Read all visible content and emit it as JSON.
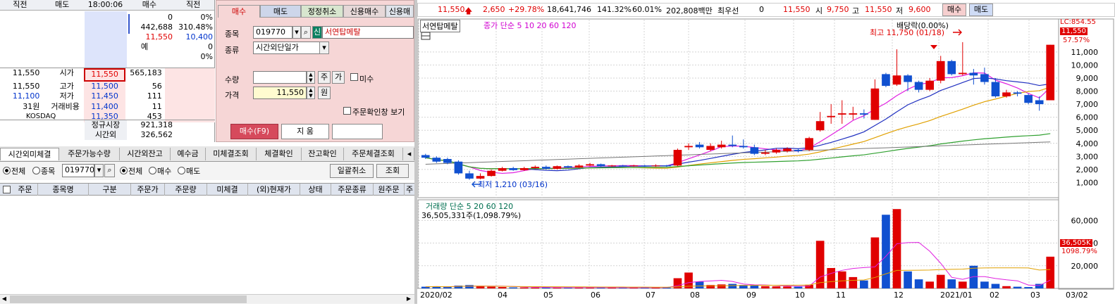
{
  "quote": {
    "header": [
      "직전",
      "매도",
      "18:00:06",
      "매수",
      "직전"
    ],
    "top_right": [
      {
        "bid": "0",
        "pct": "0%"
      },
      {
        "bid": "442,688",
        "pct": "310.48%"
      },
      {
        "bid": "11,550",
        "pct": "10,400"
      },
      {
        "bid": "예",
        "pct": "0"
      },
      {
        "bid": "",
        "pct": "0%"
      }
    ],
    "rows": [
      {
        "price": "11,550",
        "label": "시가",
        "mid": "11,550",
        "vol": "565,183"
      },
      {
        "price": "11,550",
        "label": "고가",
        "mid": "11,500",
        "vol": "56"
      },
      {
        "price": "11,100",
        "label": "저가",
        "mid": "11,450",
        "vol": "111"
      },
      {
        "price": "31원",
        "label": "거래비용",
        "mid": "11,400",
        "vol": "11"
      },
      {
        "price": "KOSDAQ",
        "label": "",
        "mid": "11,350",
        "vol": "453"
      }
    ],
    "footer": [
      {
        "label": "정규시장",
        "value": "921,318"
      },
      {
        "label": "시간외",
        "value": "326,562"
      }
    ]
  },
  "order": {
    "tabs": [
      "매수",
      "매도",
      "정정취소",
      "신용매수",
      "신용매"
    ],
    "code_label": "종목",
    "code": "019770",
    "badge": "신",
    "name": "서연탑메탈",
    "type_label": "종류",
    "type": "시간외단일가",
    "qty_label": "수량",
    "qty": "",
    "qty_btn1": "주",
    "qty_btn2": "가",
    "misu": "미수",
    "price_label": "가격",
    "price": "11,550",
    "price_unit": "원",
    "confirm": "주문확인창 보기",
    "buy": "매수(F9)",
    "clear": "지  움"
  },
  "bottom": {
    "tabs": [
      "시간외미체결",
      "주문가능수량",
      "시간외잔고",
      "예수금",
      "미체결조회",
      "체결확인",
      "잔고확인",
      "주문체결조회"
    ],
    "filter": {
      "all": "전체",
      "stock": "종목",
      "code": "019770",
      "all2": "전체",
      "buy": "매수",
      "sell": "매도",
      "cancel_all": "일괄취소",
      "query": "조회"
    },
    "columns": [
      "주문",
      "종목명",
      "구분",
      "주문가",
      "주문량",
      "미체결",
      "(외)현재가",
      "상태",
      "주문종류",
      "원주문",
      "주"
    ]
  },
  "ticker": {
    "price": "11,550",
    "change": "2,650",
    "change_pct": "+29.78%",
    "volume": "18,641,746",
    "vol_pct": "141.32%",
    "pct2": "60.01%",
    "amount": "202,808백만",
    "priority_label": "최우선",
    "priority": "0",
    "priority_price": "11,550",
    "open_label": "시",
    "open": "9,750",
    "high_label": "고",
    "high": "11,550",
    "low_label": "저",
    "low": "9,600",
    "buy_btn": "매수",
    "sell_btn": "매도"
  },
  "chart_data": {
    "type": "candlestick",
    "title": "서연탑메탈",
    "price_legend": "종가 단순 5 10 20 60 120",
    "volume_legend": "거래량 단순 5 20 60 120",
    "volume_info": "36,505,331주(1,098.79%)",
    "annotations": {
      "dividend": "배당락(0.00%)",
      "high": "최고 11,750 (01/18)",
      "low": "최저 1,210 (03/16)"
    },
    "right_labels": {
      "lc": "LC:854.55",
      "last": "11,550",
      "pct": "57.57%",
      "vol_last": "36,505K",
      "vol_pct": "1098.79%"
    },
    "x_ticks": [
      "2020/02",
      "04",
      "05",
      "06",
      "07",
      "08",
      "09",
      "10",
      "11",
      "12",
      "2021/01",
      "02",
      "03",
      "03/02"
    ],
    "price_ticks": [
      1000,
      2000,
      3000,
      4000,
      5000,
      6000,
      7000,
      8000,
      9000,
      10000,
      11000
    ],
    "price_ylim": [
      0,
      12500
    ],
    "volume_ticks": [
      20000,
      40000,
      60000
    ],
    "volume_ylim": [
      0,
      72000
    ],
    "candles": [
      {
        "o": 3100,
        "c": 2900,
        "h": 3200,
        "l": 2800
      },
      {
        "o": 2900,
        "c": 2600,
        "h": 3000,
        "l": 2500
      },
      {
        "o": 2800,
        "c": 2500,
        "h": 2900,
        "l": 2400
      },
      {
        "o": 2600,
        "c": 1700,
        "h": 2700,
        "l": 1600
      },
      {
        "o": 1700,
        "c": 1300,
        "h": 1900,
        "l": 1210
      },
      {
        "o": 1300,
        "c": 1500,
        "h": 1700,
        "l": 1250
      },
      {
        "o": 1500,
        "c": 1900,
        "h": 2000,
        "l": 1450
      },
      {
        "o": 1900,
        "c": 2100,
        "h": 2200,
        "l": 1850
      },
      {
        "o": 2100,
        "c": 1950,
        "h": 2200,
        "l": 1900
      },
      {
        "o": 1950,
        "c": 2100,
        "h": 2200,
        "l": 1900
      },
      {
        "o": 2100,
        "c": 2200,
        "h": 2300,
        "l": 2050
      },
      {
        "o": 2200,
        "c": 2050,
        "h": 2300,
        "l": 2000
      },
      {
        "o": 2050,
        "c": 2250,
        "h": 2300,
        "l": 2000
      },
      {
        "o": 2250,
        "c": 2150,
        "h": 2300,
        "l": 2100
      },
      {
        "o": 2150,
        "c": 2300,
        "h": 2400,
        "l": 2100
      },
      {
        "o": 2300,
        "c": 2400,
        "h": 2500,
        "l": 2250
      },
      {
        "o": 2400,
        "c": 2250,
        "h": 2450,
        "l": 2200
      },
      {
        "o": 2250,
        "c": 2300,
        "h": 2350,
        "l": 2200
      },
      {
        "o": 2300,
        "c": 2250,
        "h": 2350,
        "l": 2200
      },
      {
        "o": 2250,
        "c": 2300,
        "h": 2350,
        "l": 2200
      },
      {
        "o": 2300,
        "c": 2250,
        "h": 2350,
        "l": 2200
      },
      {
        "o": 2250,
        "c": 2300,
        "h": 2400,
        "l": 2200
      },
      {
        "o": 2300,
        "c": 2250,
        "h": 2350,
        "l": 2200
      },
      {
        "o": 2300,
        "c": 3500,
        "h": 3600,
        "l": 2250
      },
      {
        "o": 3700,
        "c": 3800,
        "h": 4000,
        "l": 3500
      },
      {
        "o": 3900,
        "c": 3700,
        "h": 4100,
        "l": 3600
      },
      {
        "o": 3500,
        "c": 3800,
        "h": 4000,
        "l": 3400
      },
      {
        "o": 3700,
        "c": 3900,
        "h": 4200,
        "l": 3600
      },
      {
        "o": 3900,
        "c": 3800,
        "h": 4600,
        "l": 3700
      },
      {
        "o": 3800,
        "c": 3700,
        "h": 4300,
        "l": 3600
      },
      {
        "o": 3700,
        "c": 3200,
        "h": 3900,
        "l": 3100
      },
      {
        "o": 3200,
        "c": 3300,
        "h": 3500,
        "l": 3100
      },
      {
        "o": 3300,
        "c": 3500,
        "h": 3600,
        "l": 3200
      },
      {
        "o": 3400,
        "c": 3600,
        "h": 3700,
        "l": 3300
      },
      {
        "o": 3500,
        "c": 3400,
        "h": 3600,
        "l": 3300
      },
      {
        "o": 3500,
        "c": 4400,
        "h": 4500,
        "l": 3400
      },
      {
        "o": 5000,
        "c": 5700,
        "h": 6400,
        "l": 4900
      },
      {
        "o": 6000,
        "c": 6100,
        "h": 7000,
        "l": 5500
      },
      {
        "o": 6200,
        "c": 6300,
        "h": 7300,
        "l": 5500
      },
      {
        "o": 6200,
        "c": 6300,
        "h": 6800,
        "l": 5800
      },
      {
        "o": 6300,
        "c": 6200,
        "h": 6600,
        "l": 5900
      },
      {
        "o": 5800,
        "c": 8200,
        "h": 8900,
        "l": 5800
      },
      {
        "o": 9300,
        "c": 8400,
        "h": 9400,
        "l": 8300
      },
      {
        "o": 8500,
        "c": 9200,
        "h": 11200,
        "l": 8400
      },
      {
        "o": 9200,
        "c": 8700,
        "h": 9300,
        "l": 8000
      },
      {
        "o": 8700,
        "c": 8100,
        "h": 8800,
        "l": 7900
      },
      {
        "o": 8100,
        "c": 8800,
        "h": 9000,
        "l": 8000
      },
      {
        "o": 8800,
        "c": 10300,
        "h": 10700,
        "l": 8600
      },
      {
        "o": 10300,
        "c": 9300,
        "h": 10400,
        "l": 9200
      },
      {
        "o": 9300,
        "c": 9400,
        "h": 11750,
        "l": 9200
      },
      {
        "o": 9400,
        "c": 9200,
        "h": 9700,
        "l": 8500
      },
      {
        "o": 9300,
        "c": 8700,
        "h": 9800,
        "l": 8500
      },
      {
        "o": 8700,
        "c": 7600,
        "h": 9000,
        "l": 7500
      },
      {
        "o": 7600,
        "c": 7900,
        "h": 8100,
        "l": 7500
      },
      {
        "o": 7900,
        "c": 7800,
        "h": 8000,
        "l": 7600
      },
      {
        "o": 7700,
        "c": 7100,
        "h": 7800,
        "l": 7000
      },
      {
        "o": 7300,
        "c": 7000,
        "h": 7600,
        "l": 6500
      },
      {
        "o": 7300,
        "c": 11550,
        "h": 11550,
        "l": 7300
      }
    ],
    "volumes": [
      1500,
      1800,
      1200,
      2500,
      3000,
      2000,
      1500,
      1200,
      900,
      800,
      700,
      900,
      700,
      800,
      900,
      700,
      600,
      700,
      600,
      700,
      800,
      900,
      800,
      9000,
      14000,
      6000,
      3000,
      3500,
      4000,
      3000,
      2500,
      2000,
      1800,
      1700,
      1500,
      3200,
      42000,
      18000,
      15000,
      10000,
      7000,
      45000,
      65000,
      70000,
      15000,
      8000,
      6000,
      12000,
      8000,
      6000,
      20000,
      6000,
      4000,
      2000,
      1500,
      1200,
      4000,
      28000
    ]
  }
}
